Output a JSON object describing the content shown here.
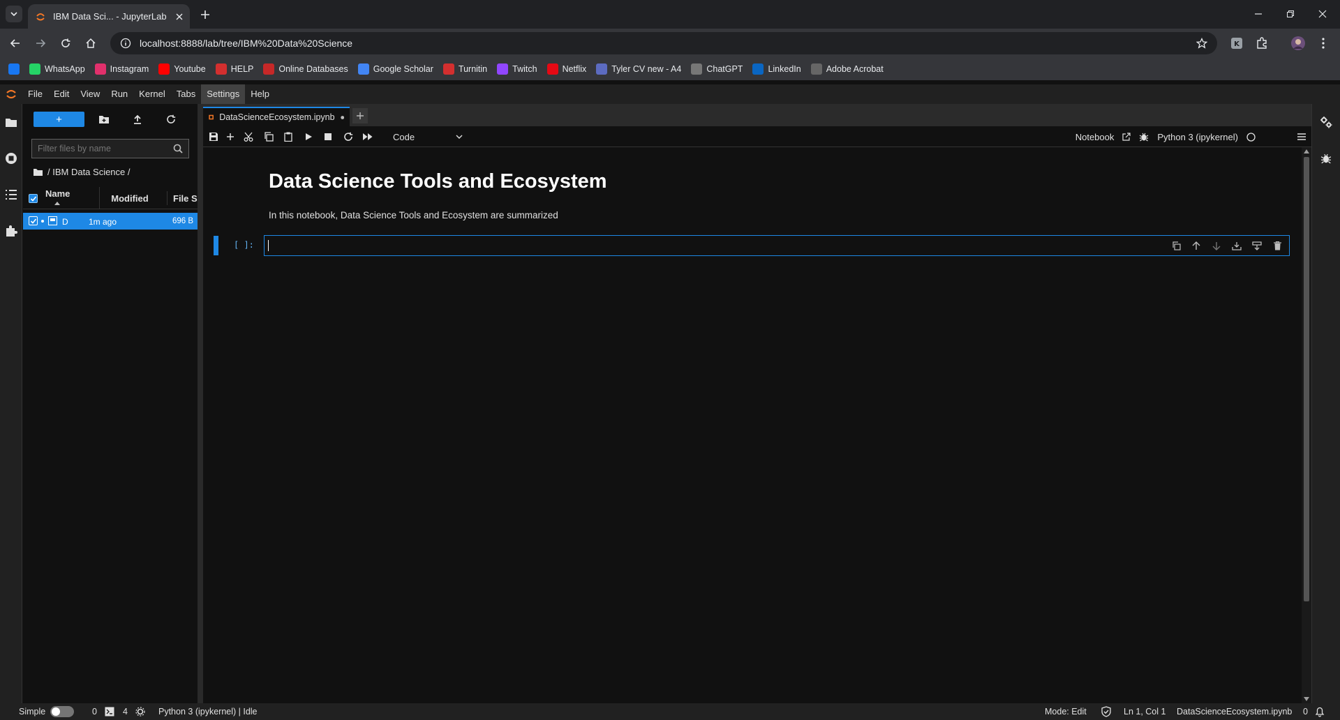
{
  "browser": {
    "tab_title": "IBM Data Sci... - JupyterLab",
    "url": "localhost:8888/lab/tree/IBM%20Data%20Science",
    "bookmarks": [
      {
        "label": "",
        "icon": "facebook-icon",
        "color": "#1877f2"
      },
      {
        "label": "WhatsApp",
        "icon": "whatsapp-icon",
        "color": "#25d366"
      },
      {
        "label": "Instagram",
        "icon": "instagram-icon",
        "color": "#e1306c"
      },
      {
        "label": "Youtube",
        "icon": "youtube-icon",
        "color": "#ff0000"
      },
      {
        "label": "HELP",
        "icon": "help-icon",
        "color": "#d32f2f"
      },
      {
        "label": "Online Databases",
        "icon": "database-icon",
        "color": "#c62828"
      },
      {
        "label": "Google Scholar",
        "icon": "scholar-icon",
        "color": "#4285f4"
      },
      {
        "label": "Turnitin",
        "icon": "turnitin-icon",
        "color": "#d32f2f"
      },
      {
        "label": "Twitch",
        "icon": "twitch-icon",
        "color": "#9146ff"
      },
      {
        "label": "Netflix",
        "icon": "netflix-icon",
        "color": "#e50914"
      },
      {
        "label": "Tyler CV new - A4",
        "icon": "document-icon",
        "color": "#5c6bc0"
      },
      {
        "label": "ChatGPT",
        "icon": "chatgpt-icon",
        "color": "#777777"
      },
      {
        "label": "LinkedIn",
        "icon": "linkedin-icon",
        "color": "#0a66c2"
      },
      {
        "label": "Adobe Acrobat",
        "icon": "acrobat-icon",
        "color": "#666666"
      }
    ]
  },
  "jupyter": {
    "menu": [
      "File",
      "Edit",
      "View",
      "Run",
      "Kernel",
      "Tabs",
      "Settings",
      "Help"
    ],
    "active_menu": "Settings",
    "filebrowser": {
      "new_label": "+",
      "filter_placeholder": "Filter files by name",
      "breadcrumb": "/ IBM Data Science /",
      "columns": {
        "name": "Name",
        "modified": "Modified",
        "size": "File Si"
      },
      "files": [
        {
          "name": "D",
          "modified": "1m ago",
          "size": "696 B"
        }
      ]
    },
    "doc_tab": "DataScienceEcosystem.ipynb",
    "notebook_toolbar": {
      "cell_type": "Code",
      "notebook_label": "Notebook",
      "kernel": "Python 3 (ipykernel)"
    },
    "notebook": {
      "heading": "Data Science Tools and Ecosystem",
      "paragraph": "In this notebook, Data Science Tools and Ecosystem are summarized",
      "prompt": "[ ]:"
    },
    "status": {
      "simple": "Simple",
      "count_a": "0",
      "count_b": "4",
      "kernel_status": "Python 3 (ipykernel) | Idle",
      "mode": "Mode: Edit",
      "position": "Ln 1, Col 1",
      "file": "DataScienceEcosystem.ipynb",
      "notifications": "0"
    }
  }
}
